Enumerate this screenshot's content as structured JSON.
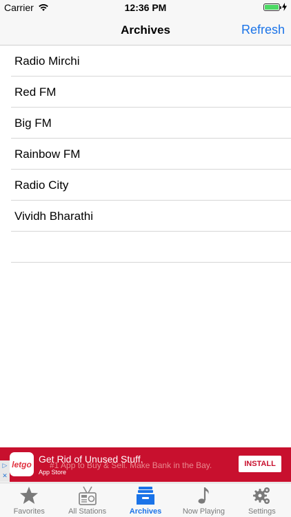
{
  "status_bar": {
    "carrier": "Carrier",
    "time": "12:36 PM",
    "battery_level": 1.0
  },
  "navbar": {
    "title": "Archives",
    "refresh_label": "Refresh"
  },
  "stations": [
    {
      "name": "Radio Mirchi"
    },
    {
      "name": "Red FM"
    },
    {
      "name": "Big FM"
    },
    {
      "name": "Rainbow FM"
    },
    {
      "name": "Radio City"
    },
    {
      "name": "Vividh Bharathi"
    },
    {
      "name": ""
    }
  ],
  "ad": {
    "brand": "letgo",
    "headline": "Get Rid of Unused Stuff.",
    "subline": "#1 App to Buy & Sell. Make Bank in the Bay.",
    "store_label": "App Store",
    "install_label": "INSTALL"
  },
  "tabs": [
    {
      "label": "Favorites",
      "icon": "star-icon",
      "active": false
    },
    {
      "label": "All Stations",
      "icon": "radio-icon",
      "active": false
    },
    {
      "label": "Archives",
      "icon": "archive-box-icon",
      "active": true
    },
    {
      "label": "Now Playing",
      "icon": "music-note-icon",
      "active": false
    },
    {
      "label": "Settings",
      "icon": "gear-icon",
      "active": false
    }
  ],
  "colors": {
    "accent": "#1a73e8",
    "ad_background": "#c8102e",
    "inactive_tab": "#7a7a7a"
  }
}
